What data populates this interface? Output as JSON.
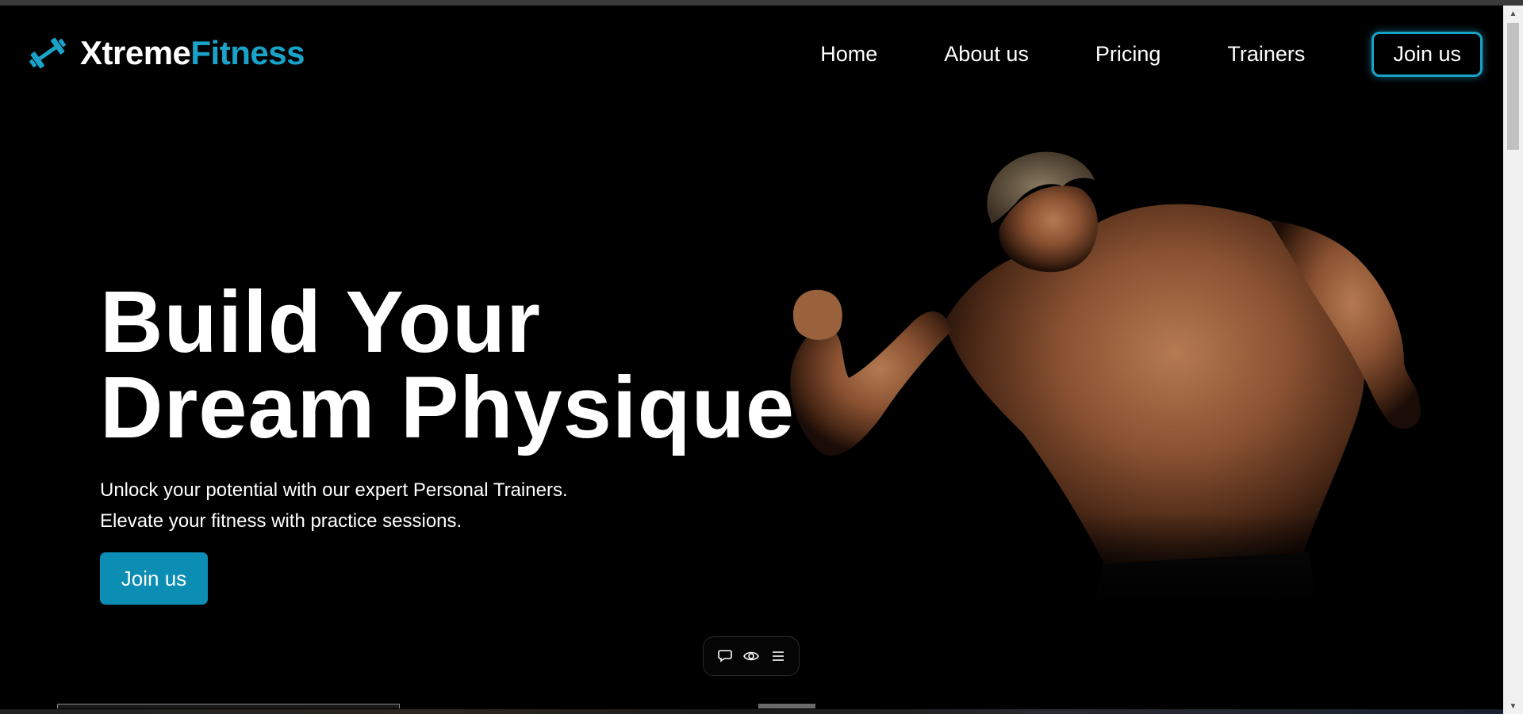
{
  "brand": {
    "name_part1": "Xtreme",
    "name_part2": "Fitness",
    "icon": "dumbbell-icon",
    "accent_color": "#1aa3c9"
  },
  "nav": {
    "items": [
      {
        "label": "Home"
      },
      {
        "label": "About us"
      },
      {
        "label": "Pricing"
      },
      {
        "label": "Trainers"
      }
    ],
    "cta_label": "Join us"
  },
  "hero": {
    "title_line1": "Build Your",
    "title_line2": "Dream Physique",
    "subtitle_line1": "Unlock your potential with our expert Personal Trainers.",
    "subtitle_line2": "Elevate your fitness with practice sessions.",
    "button_label": "Join us",
    "button_color": "#0c8db3"
  },
  "toolbar": {
    "icons": [
      "comment-icon",
      "eye-icon",
      "menu-icon"
    ]
  }
}
